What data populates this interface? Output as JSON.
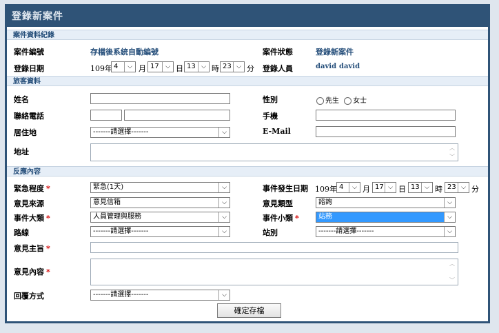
{
  "window": {
    "title": "登錄新案件"
  },
  "sections": {
    "case_record": "案件資料紀錄",
    "customer": "旅客資料",
    "feedback": "反應內容"
  },
  "case": {
    "case_no_label": "案件編號",
    "case_no_value": "存檔後系統自動編號",
    "status_label": "案件狀態",
    "status_value": "登錄新案件",
    "date_label": "登錄日期",
    "year_text": "109年",
    "month_value": "4",
    "month_unit": "月",
    "day_value": "17",
    "day_unit": "日",
    "hour_value": "13",
    "hour_unit": "時",
    "minute_value": "23",
    "minute_unit": "分",
    "registrar_label": "登錄人員",
    "registrar_1": "david",
    "registrar_2": "david"
  },
  "customer": {
    "name_label": "姓名",
    "gender_label": "性別",
    "gender_male": "先生",
    "gender_female": "女士",
    "phone_label": "聯絡電話",
    "mobile_label": "手機",
    "residence_label": "居住地",
    "residence_value": "-------請選擇-------",
    "email_label": "E-Mail",
    "address_label": "地址"
  },
  "feedback": {
    "urgency_label": "緊急程度",
    "urgency_value": "緊急(1天)",
    "event_date_label": "事件發生日期",
    "event_year_text": "109年",
    "event_month": "4",
    "event_month_unit": "月",
    "event_day": "17",
    "event_day_unit": "日",
    "event_hour": "13",
    "event_hour_unit": "時",
    "event_minute": "23",
    "event_minute_unit": "分",
    "source_label": "意見來源",
    "source_value": "意見信箱",
    "opinion_type_label": "意見類型",
    "opinion_type_value": "諮詢",
    "category_label": "事件大類",
    "category_value": "人員管理與服務",
    "subcategory_label": "事件小類",
    "subcategory_value": "站務",
    "route_label": "路線",
    "route_value": "-------請選擇-------",
    "station_label": "站別",
    "station_value": "-------請選擇-------",
    "subject_label": "意見主旨",
    "content_label": "意見內容",
    "reply_label": "回覆方式",
    "reply_value": "-------請選擇-------",
    "required_mark": "*"
  },
  "actions": {
    "save_label": "確定存檔"
  },
  "glyphs": {
    "dropdown_arrow": "⌵",
    "scroll_up": "︿",
    "scroll_down": "﹀"
  }
}
